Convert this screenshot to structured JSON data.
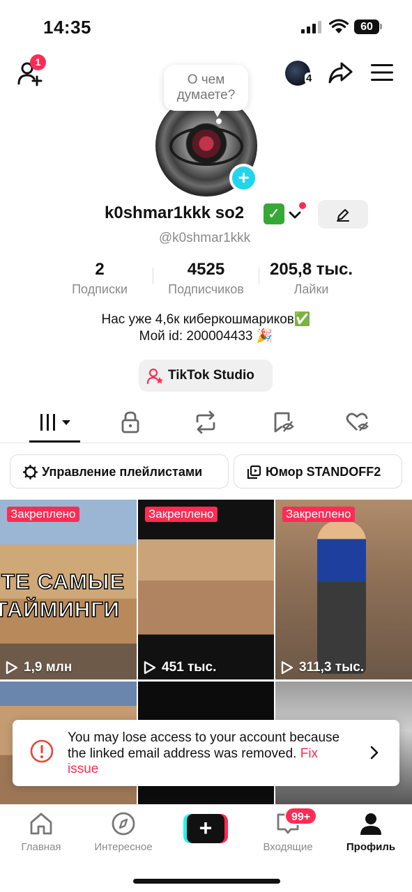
{
  "status_bar": {
    "time": "14:35",
    "battery": "60"
  },
  "top_nav": {
    "friend_requests_badge": "1",
    "accounts_count": "4"
  },
  "profile": {
    "thought_bubble": "О чем думаете?",
    "display_name": "k0shmar1kkk so2",
    "verified_glyph": "✓",
    "username": "@k0shmar1kkk",
    "stats": [
      {
        "value": "2",
        "label": "Подписки"
      },
      {
        "value": "4525",
        "label": "Подписчиков"
      },
      {
        "value": "205,8 тыс.",
        "label": "Лайки"
      }
    ],
    "bio_line1": "Нас уже 4,6к киберкошмариков✅",
    "bio_line2": "Мой id: 200004433 🎉",
    "studio_button": "TikTok Studio"
  },
  "playlists": {
    "manage_label": "Управление плейлистами",
    "playlist_label": "Юмор STANDOFF2"
  },
  "videos": [
    {
      "pinned": "Закреплено",
      "views": "1,9 млн",
      "overlay_line1": "ТЕ САМЫЕ",
      "overlay_line2": "ТАЙМИНГИ"
    },
    {
      "pinned": "Закреплено",
      "views": "451 тыс."
    },
    {
      "pinned": "Закреплено",
      "views": "311,3 тыс."
    }
  ],
  "warning": {
    "message": "You may lose access to your account because the linked email address was removed.",
    "action": "Fix issue"
  },
  "bottom_nav": {
    "home": "Главная",
    "discover": "Интересное",
    "create": "+",
    "inbox": "Входящие",
    "inbox_badge": "99+",
    "profile": "Профиль"
  },
  "colors": {
    "accent": "#fe2c55",
    "cyan": "#25f4ee",
    "verified": "#35a836"
  }
}
